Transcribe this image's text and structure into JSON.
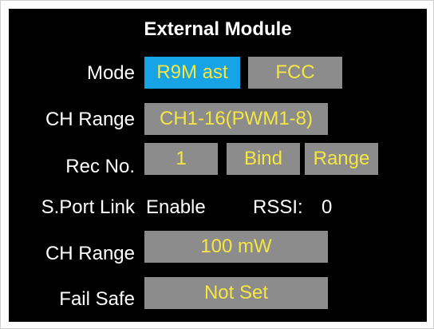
{
  "screen": {
    "title": "External Module"
  },
  "rows": {
    "mode": {
      "label": "Mode",
      "type_value": "R9M ast",
      "region_value": "FCC"
    },
    "channel_range": {
      "label": "CH Range",
      "value": "CH1-16(PWM1-8)"
    },
    "receiver": {
      "label": "Rec No.",
      "number": "1",
      "bind_label": "Bind",
      "range_label": "Range"
    },
    "sport_link": {
      "label": "S.Port Link",
      "status": "Enable",
      "rssi_label": "RSSI:",
      "rssi_value": "0"
    },
    "power": {
      "label": "CH Range",
      "value": "100 mW"
    },
    "failsafe": {
      "label": "Fail Safe",
      "value": "Not Set"
    }
  },
  "colors": {
    "background": "#000000",
    "field": "#8c8c8c",
    "selected": "#16a4e6",
    "value_text": "#f5e642",
    "label_text": "#ffffff"
  }
}
